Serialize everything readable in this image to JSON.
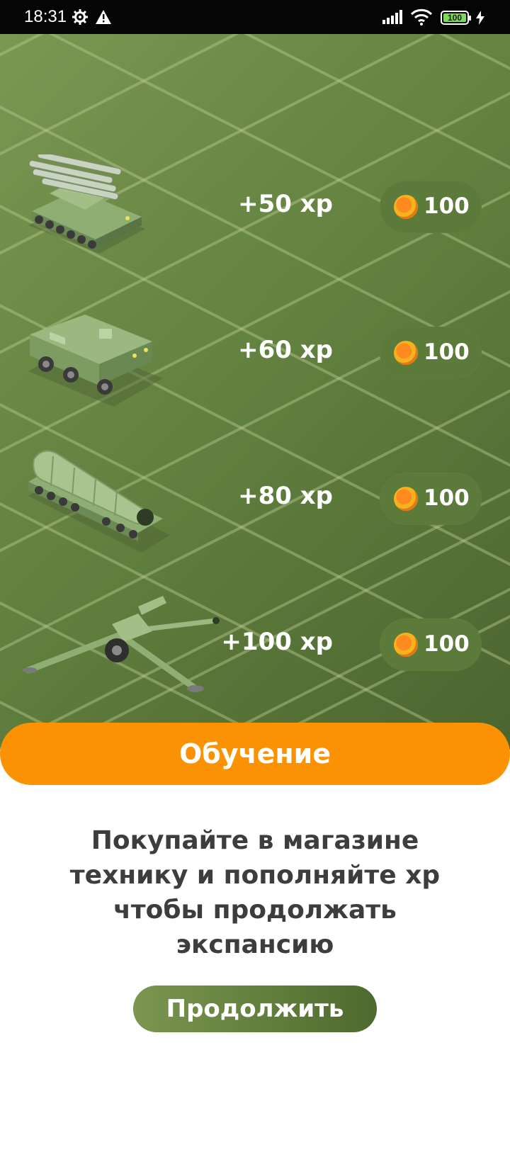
{
  "status_bar": {
    "time": "18:31",
    "battery": "100"
  },
  "shop": {
    "items": [
      {
        "vehicle": "sam-launcher",
        "xp": "+50 xp",
        "price": "100"
      },
      {
        "vehicle": "armored-carrier",
        "xp": "+60 xp",
        "price": "100"
      },
      {
        "vehicle": "missile-transporter",
        "xp": "+80 xp",
        "price": "100"
      },
      {
        "vehicle": "howitzer",
        "xp": "+100 xp",
        "price": "100"
      }
    ],
    "icon": "coin-icon"
  },
  "tutorial": {
    "title": "Обучение",
    "message_lines": [
      "Покупайте в магазине",
      "технику и пополняйте xp",
      "чтобы продолжать",
      "экспансию"
    ],
    "continue_label": "Продолжить"
  },
  "colors": {
    "accent": "#fb9203",
    "field": "#6b8a45",
    "button": "#5f7c3a"
  }
}
